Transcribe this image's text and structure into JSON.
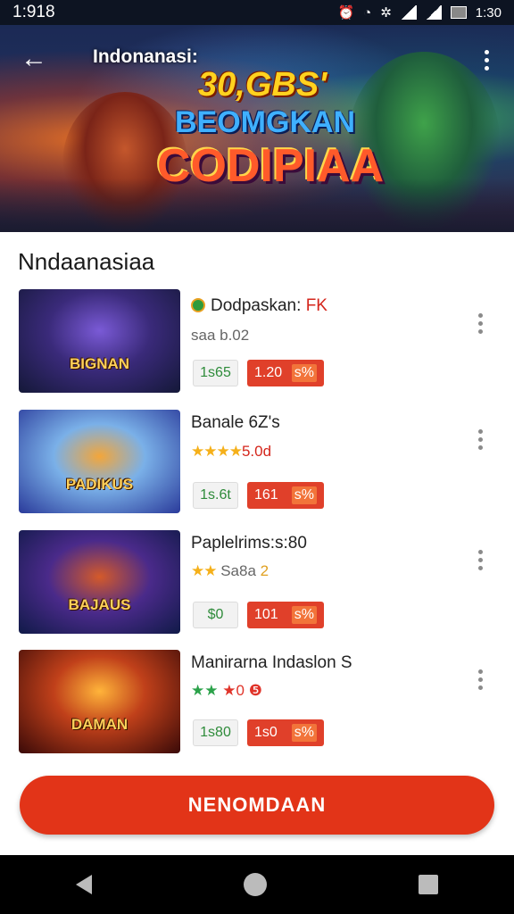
{
  "status_bar": {
    "time_left": "1:918",
    "time_right": "1:30"
  },
  "hero": {
    "title": "Indonanasi:",
    "promo_line1": "30,GBS'",
    "promo_line2": "BEOMGKAN",
    "promo_line3": "CODIPIAA"
  },
  "section": {
    "title": "Nndaanasiaa"
  },
  "games": [
    {
      "title": "Dodpaskan:",
      "title_accent": "FK",
      "subtitle": "saa b.02",
      "thumb_label": "BIGNAN",
      "price": "1s65",
      "discount": "1.20",
      "discount_pct": "s%"
    },
    {
      "title": "Banale 6Z's",
      "stars": "★★★★",
      "subtitle": "5.0d",
      "thumb_label": "PADIKUS",
      "price": "1s.6t",
      "discount": "161",
      "discount_pct": "s%"
    },
    {
      "title": "Paplelrims:s:80",
      "stars": "★★",
      "subtitle": "Sa8a",
      "subtitle_accent": "2",
      "thumb_label": "BAJAUS",
      "price": "$0",
      "discount": "101",
      "discount_pct": "s%"
    },
    {
      "title": "Manirarna Indaslon S",
      "stars": "★★",
      "stars_red": "★0 ❺",
      "thumb_label": "DAMAN",
      "price": "1s80",
      "discount": "1s0",
      "discount_pct": "s%"
    }
  ],
  "cta": {
    "label": "NENOMDAAN"
  }
}
